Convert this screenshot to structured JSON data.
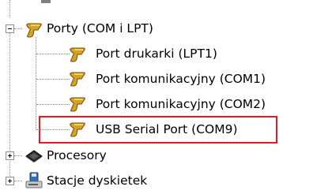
{
  "tree": {
    "category_ports": {
      "label": "Porty (COM i LPT)",
      "expanded": true,
      "icon": "port-icon"
    },
    "ports": [
      {
        "label": "Port drukarki (LPT1)",
        "icon": "port-icon"
      },
      {
        "label": "Port komunikacyjny (COM1)",
        "icon": "port-icon"
      },
      {
        "label": "Port komunikacyjny (COM2)",
        "icon": "port-icon"
      },
      {
        "label": "USB Serial Port (COM9)",
        "icon": "port-icon",
        "highlighted": true
      }
    ],
    "category_processors": {
      "label": "Procesory",
      "expanded": false,
      "icon": "processor-chip-icon"
    },
    "category_floppy": {
      "label": "Stacje dyskietek",
      "expanded": false,
      "icon": "floppy-drive-icon"
    }
  },
  "colors": {
    "highlight_border": "#e01b24",
    "port_icon_gold": "#d9a21e",
    "tree_lines": "#8a8a8a"
  }
}
